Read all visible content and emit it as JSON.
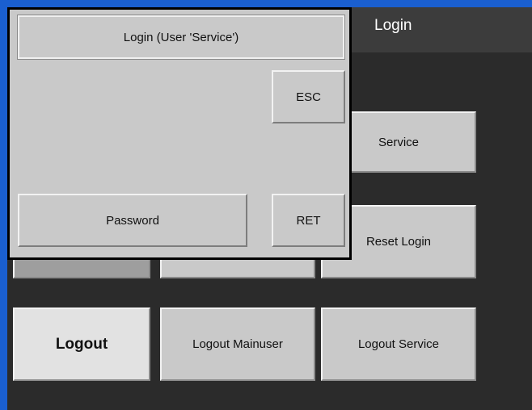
{
  "header": {
    "title": "Login"
  },
  "dialog": {
    "title": "Login (User 'Service')",
    "esc_label": "ESC",
    "password_label": "Password",
    "ret_label": "RET"
  },
  "buttons": {
    "service": "Service",
    "reset_login": "Reset Login",
    "logout": "Logout",
    "logout_mainuser": "Logout Mainuser",
    "logout_service": "Logout Service"
  }
}
